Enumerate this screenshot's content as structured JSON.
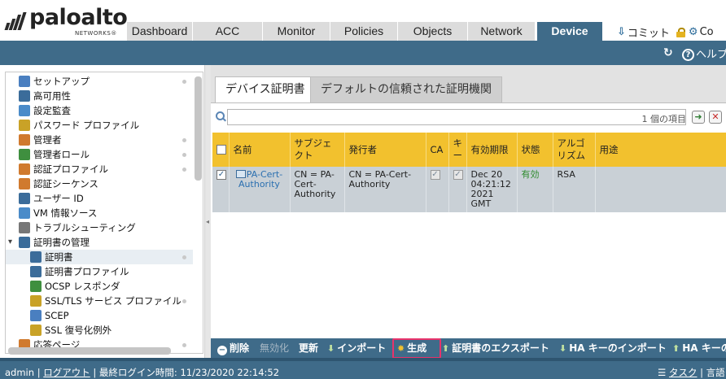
{
  "brand": {
    "name": "paloalto",
    "sub": "NETWORKS®"
  },
  "tabs": [
    {
      "label": "Dashboard",
      "active": false
    },
    {
      "label": "ACC",
      "active": false
    },
    {
      "label": "Monitor",
      "active": false
    },
    {
      "label": "Policies",
      "active": false
    },
    {
      "label": "Objects",
      "active": false
    },
    {
      "label": "Network",
      "active": false
    },
    {
      "label": "Device",
      "active": true
    }
  ],
  "topright": {
    "commit": "コミット",
    "config": "Co"
  },
  "bluebar": {
    "help": "ヘルプ"
  },
  "nav": [
    {
      "label": "セットアップ",
      "icon": "setup-icon",
      "color": "#4a7fc0",
      "dot": true
    },
    {
      "label": "高可用性",
      "icon": "ha-icon",
      "color": "#3b6c9a",
      "dot": false
    },
    {
      "label": "設定監査",
      "icon": "audit-icon",
      "color": "#4a8bc9",
      "dot": false
    },
    {
      "label": "パスワード プロファイル",
      "icon": "password-icon",
      "color": "#c9a227",
      "dot": false
    },
    {
      "label": "管理者",
      "icon": "admin-icon",
      "color": "#d07a2e",
      "dot": true
    },
    {
      "label": "管理者ロール",
      "icon": "admin-role-icon",
      "color": "#3f8f3f",
      "dot": true
    },
    {
      "label": "認証プロファイル",
      "icon": "auth-profile-icon",
      "color": "#d07a2e",
      "dot": true
    },
    {
      "label": "認証シーケンス",
      "icon": "auth-sequence-icon",
      "color": "#d07a2e",
      "dot": false
    },
    {
      "label": "ユーザー ID",
      "icon": "user-id-icon",
      "color": "#3b6c9a",
      "dot": false
    },
    {
      "label": "VM 情報ソース",
      "icon": "vm-icon",
      "color": "#4a8bc9",
      "dot": false
    },
    {
      "label": "トラブルシューティング",
      "icon": "troubleshoot-icon",
      "color": "#777777",
      "dot": false
    },
    {
      "label": "証明書の管理",
      "icon": "cert-mgmt-icon",
      "color": "#3b6c9a",
      "dot": false,
      "expanded": true
    },
    {
      "label": "証明書",
      "icon": "certificate-icon",
      "color": "#3b6c9a",
      "dot": true,
      "selected": true,
      "child": true
    },
    {
      "label": "証明書プロファイル",
      "icon": "cert-profile-icon",
      "color": "#3b6c9a",
      "dot": false,
      "child": true
    },
    {
      "label": "OCSP レスポンダ",
      "icon": "ocsp-icon",
      "color": "#3f8f3f",
      "dot": false,
      "child": true
    },
    {
      "label": "SSL/TLS サービス プロファイル",
      "icon": "ssl-tls-icon",
      "color": "#c9a227",
      "dot": true,
      "child": true
    },
    {
      "label": "SCEP",
      "icon": "scep-icon",
      "color": "#4a7fc0",
      "dot": false,
      "child": true
    },
    {
      "label": "SSL 復号化例外",
      "icon": "ssl-exclusion-icon",
      "color": "#c9a227",
      "dot": false,
      "child": true
    },
    {
      "label": "応答ページ",
      "icon": "response-page-icon",
      "color": "#d07a2e",
      "dot": true
    }
  ],
  "content_tabs": [
    {
      "label": "デバイス証明書",
      "active": true
    },
    {
      "label": "デフォルトの信頼された証明機関",
      "active": false
    }
  ],
  "search": {
    "value": "",
    "count": "1 個の項目"
  },
  "table": {
    "headers": [
      "名前",
      "サブジェクト",
      "発行者",
      "CA",
      "キー",
      "有効期限",
      "状態",
      "アルゴリズム",
      "用途"
    ],
    "rows": [
      {
        "name": "PA-Cert-Authority",
        "subject": "CN = PA-Cert-Authority",
        "issuer": "CN = PA-Cert-Authority",
        "ca": true,
        "key": true,
        "expires": "Dec 20 04:21:12 2021 GMT",
        "status": "有効",
        "algorithm": "RSA",
        "usage": ""
      }
    ]
  },
  "toolbar": {
    "delete": "削除",
    "disable": "無効化",
    "renew": "更新",
    "import": "インポート",
    "generate": "生成",
    "export": "証明書のエクスポート",
    "ha_import": "HA キーのインポート",
    "ha_export": "HA キーの"
  },
  "footer": {
    "user": "admin",
    "logout": "ログアウト",
    "last_login": "最終ログイン時間: 11/23/2020 22:14:52",
    "tasks": "タスク",
    "language": "言語"
  }
}
